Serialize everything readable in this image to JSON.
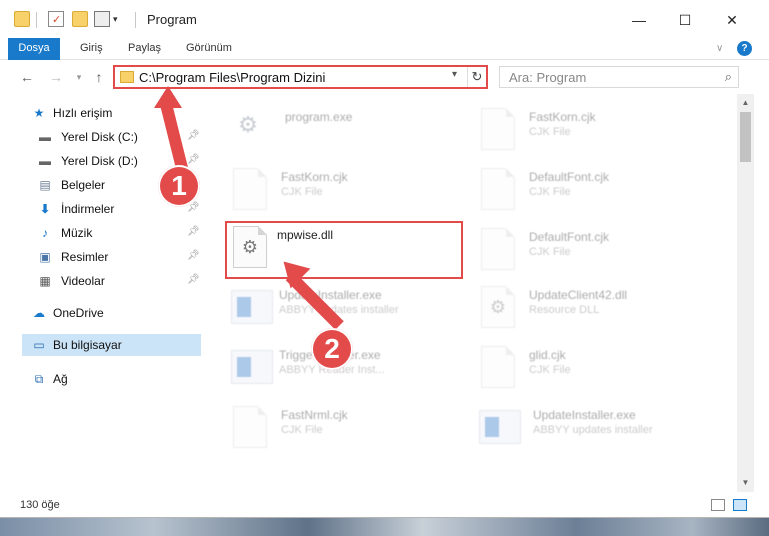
{
  "window": {
    "title": "Program",
    "minimize": "—",
    "maximize": "☐",
    "close": "✕",
    "collapse_ribbon": "∨",
    "help": "?"
  },
  "ribbon": {
    "tabs": [
      "Dosya",
      "Giriş",
      "Paylaş",
      "Görünüm"
    ]
  },
  "address": {
    "path": "C:\\Program Files\\Program Dizini",
    "search_placeholder": "Ara: Program"
  },
  "sidebar": {
    "items": [
      {
        "label": "Hızlı erişim",
        "icon": "star-icon",
        "pinned": false
      },
      {
        "label": "Yerel Disk (C:)",
        "icon": "drive-icon",
        "pinned": true
      },
      {
        "label": "Yerel Disk (D:)",
        "icon": "drive-icon",
        "pinned": true
      },
      {
        "label": "Belgeler",
        "icon": "documents-icon",
        "pinned": true
      },
      {
        "label": "İndirmeler",
        "icon": "download-icon",
        "pinned": true
      },
      {
        "label": "Müzik",
        "icon": "music-icon",
        "pinned": true
      },
      {
        "label": "Resimler",
        "icon": "pictures-icon",
        "pinned": true
      },
      {
        "label": "Videolar",
        "icon": "videos-icon",
        "pinned": true
      },
      {
        "label": "OneDrive",
        "icon": "cloud-icon",
        "pinned": false
      },
      {
        "label": "Bu bilgisayar",
        "icon": "computer-icon",
        "pinned": false,
        "selected": true
      },
      {
        "label": "Ağ",
        "icon": "network-icon",
        "pinned": false
      }
    ]
  },
  "files": [
    {
      "name": "program.exe",
      "type": "",
      "kind": "exe",
      "faded": true
    },
    {
      "name": "FastKorn.cjk",
      "type": "CJK File",
      "kind": "doc",
      "faded": true
    },
    {
      "name": "FastKorn.cjk",
      "type": "CJK File",
      "kind": "doc",
      "faded": true
    },
    {
      "name": "DefaultFont.cjk",
      "type": "CJK File",
      "kind": "doc",
      "faded": true
    },
    {
      "name": "mpwise.dll",
      "type": "",
      "kind": "gear",
      "faded": false,
      "highlighted": true
    },
    {
      "name": "DefaultFont.cjk",
      "type": "CJK File",
      "kind": "doc",
      "faded": true
    },
    {
      "name": "UpdateInstaller.exe",
      "type": "ABBYY updates installer",
      "kind": "app",
      "faded": true
    },
    {
      "name": "UpdateClient42.dll",
      "type": "Resource DLL",
      "kind": "gear",
      "faded": true
    },
    {
      "name": "TriggerInstaller.exe",
      "type": "ABBYY Reader Inst...",
      "kind": "app",
      "faded": true
    },
    {
      "name": "glid.cjk",
      "type": "CJK File",
      "kind": "doc",
      "faded": true
    },
    {
      "name": "FastNrml.cjk",
      "type": "CJK File",
      "kind": "doc",
      "faded": true
    },
    {
      "name": "UpdateInstaller.exe",
      "type": "ABBYY updates installer",
      "kind": "app",
      "faded": true
    }
  ],
  "status": {
    "count": "130 öğe"
  },
  "annotations": {
    "step1": "1",
    "step2": "2",
    "color": "#e34b4b"
  }
}
